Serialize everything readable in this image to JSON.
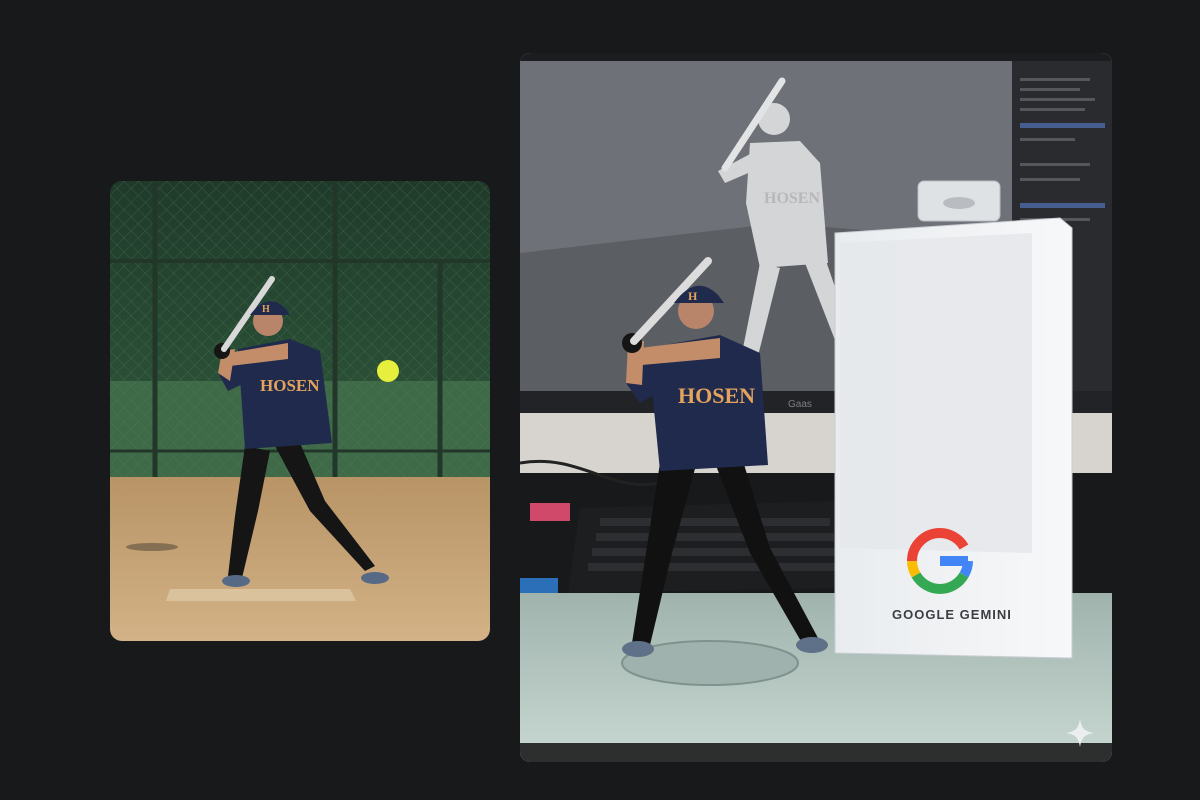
{
  "photos": [
    {
      "id": "real-batter-photo"
    },
    {
      "id": "figurine-photo"
    }
  ],
  "jersey_text": "HOSEN",
  "cap_letter": "H",
  "figure_box": {
    "brand_text": "GOOGLE GEMINI",
    "logo_letter": "G"
  },
  "monitor_brand": "Gaas",
  "colors": {
    "background": "#18191b",
    "jersey": "#1f2a4d",
    "jersey_text": "#e3a35d",
    "dirt": "#c7a57a",
    "fence": "#2b4a36",
    "ball": "#e6ef3b",
    "google_blue": "#4285F4",
    "google_red": "#EA4335",
    "google_yellow": "#FBBC05",
    "google_green": "#34A853"
  },
  "icons": [
    "sparkle-icon",
    "google-g-logo"
  ]
}
